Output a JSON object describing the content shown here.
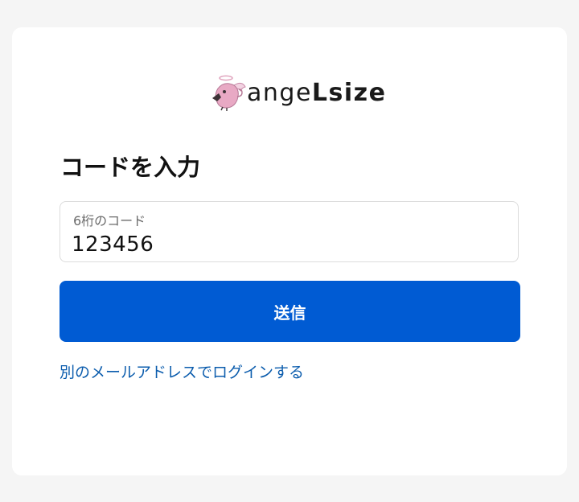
{
  "brand": {
    "name_part1": "ange",
    "name_part2": "Lsize",
    "mascot_icon": "angel-bird-mascot-icon"
  },
  "form": {
    "title": "コードを入力",
    "code_field": {
      "label": "6桁のコード",
      "value": "123456"
    },
    "submit_label": "送信",
    "alt_login_link": "別のメールアドレスでログインする"
  },
  "colors": {
    "page_background": "#f5f5f5",
    "card_background": "#ffffff",
    "primary_button": "#005bd3",
    "link": "#0b5cad",
    "mascot_pink": "#e8a9c4"
  }
}
